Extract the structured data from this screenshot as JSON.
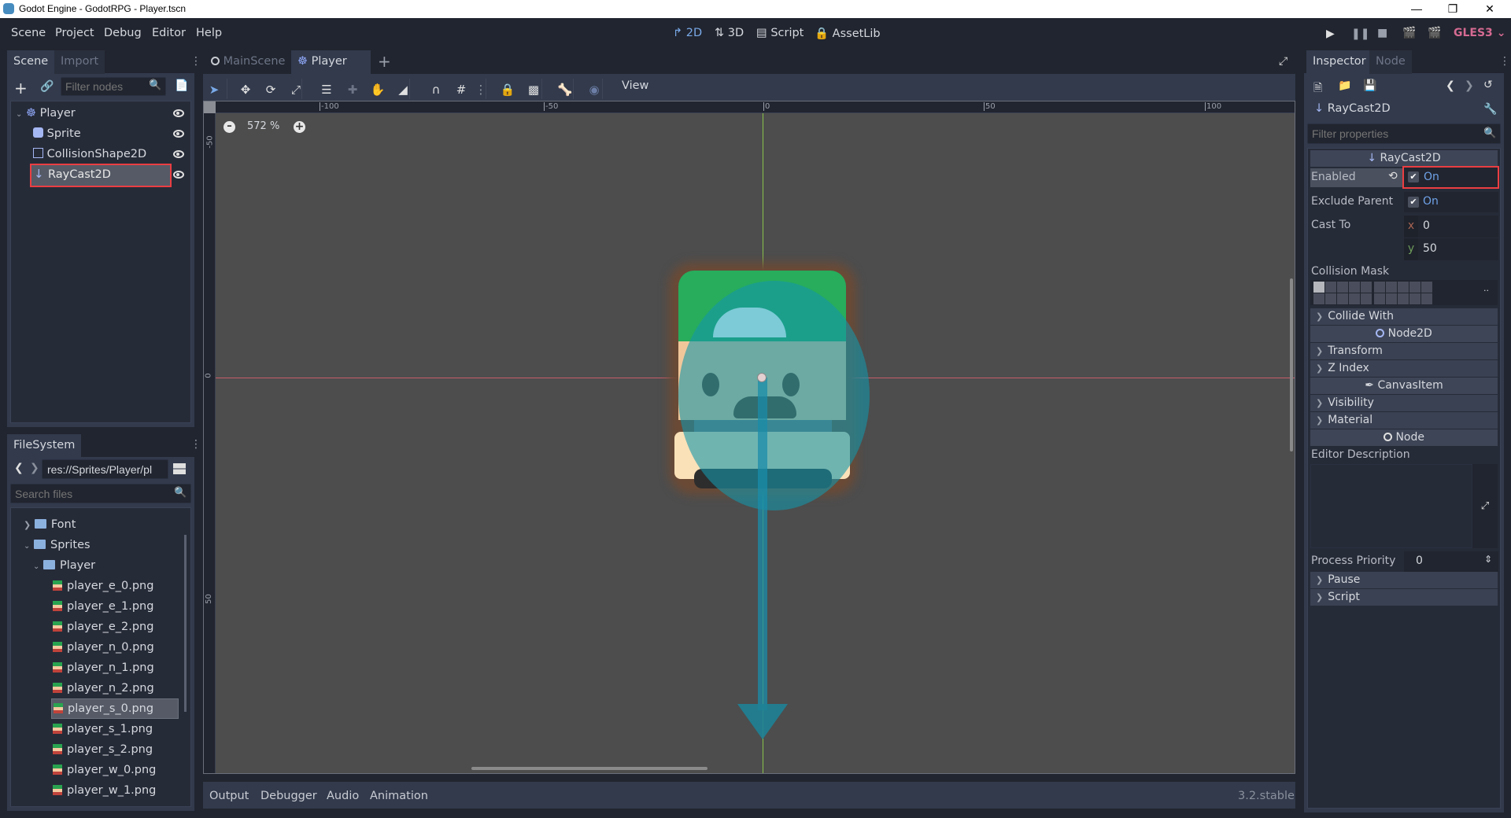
{
  "window": {
    "title": "Godot Engine - GodotRPG - Player.tscn",
    "minimize_icon": "minimize-icon",
    "maximize_icon": "restore-icon",
    "close_icon": "close-icon"
  },
  "menu": {
    "items": [
      "Scene",
      "Project",
      "Debug",
      "Editor",
      "Help"
    ]
  },
  "workspaces": {
    "items": [
      {
        "label": "2D",
        "icon": "2d-icon",
        "active": true
      },
      {
        "label": "3D",
        "icon": "3d-icon"
      },
      {
        "label": "Script",
        "icon": "script-icon"
      },
      {
        "label": "AssetLib",
        "icon": "assetlib-icon"
      }
    ]
  },
  "run_controls": {
    "renderer": "GLES3",
    "accent": "#d56a92"
  },
  "scene_dock": {
    "tabs": [
      "Scene",
      "Import"
    ],
    "filter_placeholder": "Filter nodes",
    "nodes": [
      {
        "name": "Player",
        "icon": "kinematic-body-icon",
        "visible": true
      },
      {
        "name": "Sprite",
        "icon": "sprite-icon",
        "visible": true
      },
      {
        "name": "CollisionShape2D",
        "icon": "collision-shape-icon",
        "visible": true
      },
      {
        "name": "RayCast2D",
        "icon": "raycast-icon",
        "visible": true,
        "selected": true
      }
    ]
  },
  "filesystem": {
    "tab": "FileSystem",
    "path": "res://Sprites/Player/pl",
    "search_placeholder": "Search files",
    "items": [
      {
        "name": "Font",
        "type": "folder",
        "collapsed": true
      },
      {
        "name": "Sprites",
        "type": "folder"
      },
      {
        "name": "Player",
        "type": "folder"
      },
      {
        "name": "player_e_0.png",
        "type": "file"
      },
      {
        "name": "player_e_1.png",
        "type": "file"
      },
      {
        "name": "player_e_2.png",
        "type": "file"
      },
      {
        "name": "player_n_0.png",
        "type": "file"
      },
      {
        "name": "player_n_1.png",
        "type": "file"
      },
      {
        "name": "player_n_2.png",
        "type": "file"
      },
      {
        "name": "player_s_0.png",
        "type": "file",
        "selected": true
      },
      {
        "name": "player_s_1.png",
        "type": "file"
      },
      {
        "name": "player_s_2.png",
        "type": "file"
      },
      {
        "name": "player_w_0.png",
        "type": "file"
      },
      {
        "name": "player_w_1.png",
        "type": "file"
      }
    ]
  },
  "editor_tabs": {
    "items": [
      {
        "label": "MainScene",
        "icon": "node-icon"
      },
      {
        "label": "Player",
        "icon": "kinematic-body-icon",
        "active": true
      }
    ]
  },
  "viewport": {
    "toolbar": {
      "view_label": "View"
    },
    "zoom": "572 %",
    "ruler_h": [
      "-100",
      "-50",
      "0",
      "50",
      "100"
    ],
    "ruler_v": [
      "-50",
      "0",
      "50"
    ]
  },
  "bottom_panel": {
    "tabs": [
      "Output",
      "Debugger",
      "Audio",
      "Animation"
    ],
    "version": "3.2.stable"
  },
  "inspector": {
    "tabs": [
      "Inspector",
      "Node"
    ],
    "node_name": "RayCast2D",
    "filter_placeholder": "Filter properties",
    "class_header": "RayCast2D",
    "properties": {
      "enabled": {
        "label": "Enabled",
        "value": "On",
        "checked": true
      },
      "exclude_parent": {
        "label": "Exclude Parent",
        "value": "On",
        "checked": true
      },
      "cast_to": {
        "label": "Cast To",
        "x": "0",
        "y": "50"
      },
      "collision_mask": {
        "label": "Collision Mask",
        "layers_on": [
          1
        ]
      },
      "collide_with": "Collide With"
    },
    "sections": {
      "node2d": "Node2D",
      "transform": "Transform",
      "z_index": "Z Index",
      "canvas_item": "CanvasItem",
      "visibility": "Visibility",
      "material": "Material",
      "node": "Node",
      "pause": "Pause",
      "script": "Script"
    },
    "editor_description": {
      "label": "Editor Description",
      "value": ""
    },
    "process_priority": {
      "label": "Process Priority",
      "value": "0"
    }
  }
}
